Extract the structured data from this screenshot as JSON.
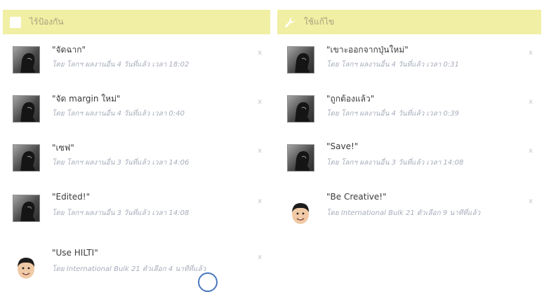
{
  "left_panel": {
    "title": "ไร้ป้องกัน",
    "icon": "checkbox-icon",
    "items": [
      {
        "title": "\"จัดฉาก\"",
        "meta": "โดย โลกฯ ผลงานอื่น 4 วันที่แล้ว เวลา 18:02",
        "avatar": "sketch"
      },
      {
        "title": "\"จัด margin ใหม่\"",
        "meta": "โดย โลกฯ ผลงานอื่น 4 วันที่แล้ว เวลา 0:40",
        "avatar": "sketch"
      },
      {
        "title": "\"เซฟ\"",
        "meta": "โดย โลกฯ ผลงานอื่น 3 วันที่แล้ว เวลา 14:06",
        "avatar": "sketch"
      },
      {
        "title": "\"Edited!\"",
        "meta": "โดย โลกฯ ผลงานอื่น 3 วันที่แล้ว เวลา 14:08",
        "avatar": "sketch"
      },
      {
        "title": "\"Use HILTI\"",
        "meta": "โดย International Bulk 21 ตัวเลือก 4 นาทีที่แล้ว",
        "avatar": "face"
      }
    ]
  },
  "right_panel": {
    "title": "ใช้แก้ไข",
    "icon": "wrench-icon",
    "items": [
      {
        "title": "\"เขาะออกจากปุ่นใหม่\"",
        "meta": "โดย โลกฯ ผลงานอื่น 4 วันที่แล้ว เวลา 0:31",
        "avatar": "sketch"
      },
      {
        "title": "\"ถูกต้องแล้ว\"",
        "meta": "โดย โลกฯ ผลงานอื่น 4 วันที่แล้ว เวลา 0:39",
        "avatar": "sketch"
      },
      {
        "title": "\"Save!\"",
        "meta": "โดย โลกฯ ผลงานอื่น 3 วันที่แล้ว เวลา 14:08",
        "avatar": "sketch"
      },
      {
        "title": "\"Be Creative!\"",
        "meta": "โดย International Bulk 21 ตัวเลือก 9 นาทีที่แล้ว",
        "avatar": "face"
      }
    ]
  },
  "close_glyph": "x",
  "colors": {
    "header_bg": "#f1efa3",
    "header_text": "#a8a080",
    "meta_text": "#8f97a8",
    "cursor": "#4a78bd"
  }
}
